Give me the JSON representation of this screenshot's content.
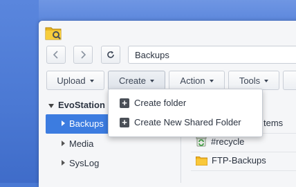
{
  "toolbar": {
    "address": "Backups",
    "upload": "Upload",
    "create": "Create",
    "action": "Action",
    "tools": "Tools"
  },
  "sidebar": {
    "root": "EvoStation",
    "items": [
      "Backups",
      "Media",
      "SysLog"
    ]
  },
  "content": {
    "items_partial": "tems",
    "files": [
      "#recycle",
      "FTP-Backups"
    ]
  },
  "create_menu": {
    "items": [
      "Create folder",
      "Create New Shared Folder"
    ]
  },
  "colors": {
    "accent": "#3c7ce0",
    "desktop": "#4a79d4"
  }
}
